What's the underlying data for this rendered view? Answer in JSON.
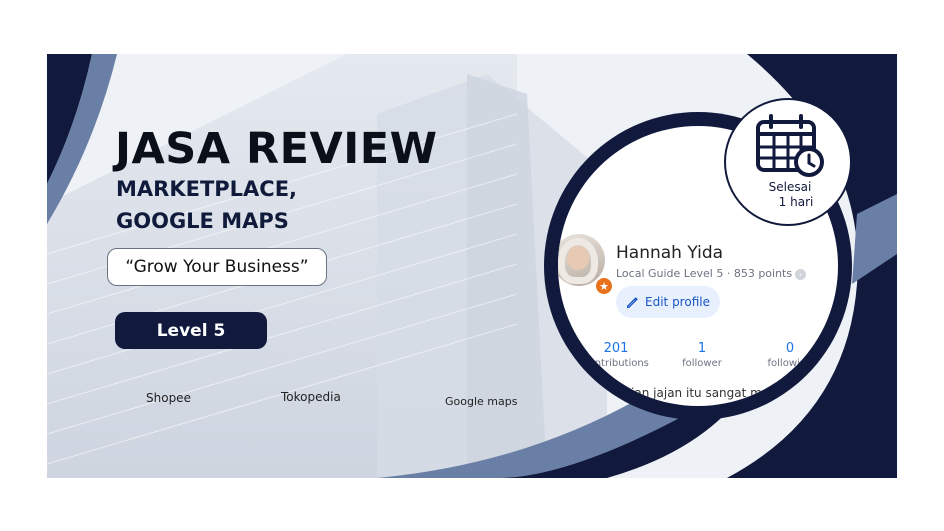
{
  "headline": {
    "title": "JASA REVIEW",
    "line1": "MARKETPLACE,",
    "line2": "GOOGLE MAPS",
    "slogan": "“Grow Your Business”",
    "level_button": "Level 5"
  },
  "marketplaces": [
    "Shopee",
    "Tokopedia",
    "Google maps"
  ],
  "profile": {
    "name": "Hannah Yida",
    "guide_line": "Local Guide Level 5 · 853 points",
    "edit_label": "Edit profile",
    "stats": [
      {
        "value": "201",
        "label": "contributions"
      },
      {
        "value": "1",
        "label": "follower"
      },
      {
        "value": "0",
        "label": "following"
      }
    ],
    "review_snippet": "dan jajan jajan itu sangat menyen"
  },
  "completion": {
    "line1": "Selesai",
    "line2": "1 hari"
  },
  "icons": {
    "calendar": "calendar-clock-icon",
    "edit": "pencil-icon",
    "badge": "star-badge-icon"
  },
  "colors": {
    "navy": "#111a3d",
    "steel_blue": "#6a7fa6",
    "edit_blue": "#1a56c4",
    "badge_orange": "#e8711c"
  }
}
